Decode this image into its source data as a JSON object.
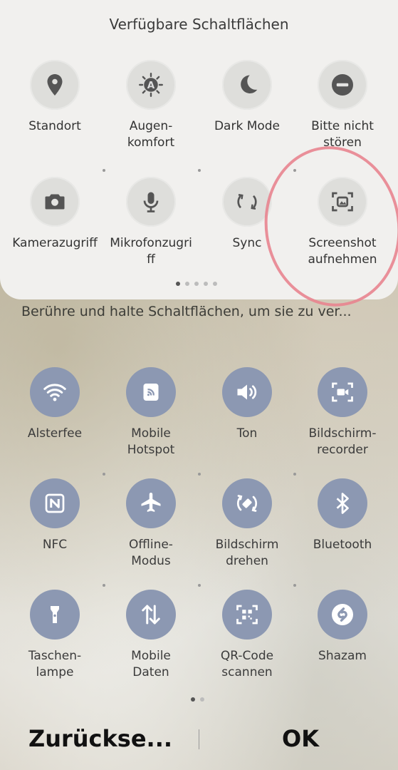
{
  "available": {
    "title": "Verfügbare Schaltflächen",
    "tiles": [
      {
        "label": "Standort",
        "icon": "location-pin-icon"
      },
      {
        "label": "Augen-\nkomfort",
        "icon": "eye-comfort-icon"
      },
      {
        "label": "Dark Mode",
        "icon": "moon-icon"
      },
      {
        "label": "Bitte nicht\nstören",
        "icon": "do-not-disturb-icon"
      },
      {
        "label": "Kamerazugriff",
        "icon": "camera-icon"
      },
      {
        "label": "Mikrofonzugri\nff",
        "icon": "microphone-icon"
      },
      {
        "label": "Sync",
        "icon": "sync-icon"
      },
      {
        "label": "Screenshot\naufnehmen",
        "icon": "screenshot-icon"
      }
    ],
    "pager_total": 5,
    "pager_active": 1
  },
  "hint": "Berühre und halte Schaltflächen, um sie zu ver...",
  "active": {
    "tiles": [
      {
        "label": "Alsterfee",
        "icon": "wifi-icon"
      },
      {
        "label": "Mobile\nHotspot",
        "icon": "hotspot-icon"
      },
      {
        "label": "Ton",
        "icon": "sound-icon"
      },
      {
        "label": "Bildschirm-\nrecorder",
        "icon": "screen-recorder-icon"
      },
      {
        "label": "NFC",
        "icon": "nfc-icon"
      },
      {
        "label": "Offline-\nModus",
        "icon": "airplane-icon"
      },
      {
        "label": "Bildschirm\ndrehen",
        "icon": "rotate-icon"
      },
      {
        "label": "Bluetooth",
        "icon": "bluetooth-icon"
      },
      {
        "label": "Taschen-\nlampe",
        "icon": "flashlight-icon"
      },
      {
        "label": "Mobile\nDaten",
        "icon": "mobile-data-icon"
      },
      {
        "label": "QR-Code\nscannen",
        "icon": "qr-code-icon"
      },
      {
        "label": "Shazam",
        "icon": "shazam-icon"
      }
    ],
    "pager_total": 2,
    "pager_active": 1
  },
  "footer": {
    "reset_label": "Zurückse...",
    "ok_label": "OK"
  },
  "colors": {
    "panel": "#f1f0ee",
    "active_tile": "#8c98b2",
    "inactive_tile": "#dededb",
    "annotation": "#e8848f"
  }
}
